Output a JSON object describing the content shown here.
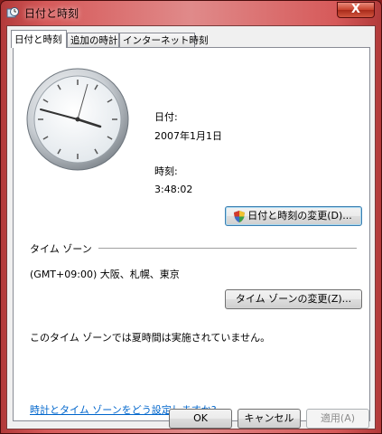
{
  "window": {
    "title": "日付と時刻",
    "close_label": "X"
  },
  "tabs": [
    {
      "label": "日付と時刻"
    },
    {
      "label": "追加の時計"
    },
    {
      "label": "インターネット時刻"
    }
  ],
  "date": {
    "label": "日付:",
    "value": "2007年1月1日"
  },
  "time": {
    "label": "時刻:",
    "value": "3:48:02"
  },
  "change_datetime_button": "日付と時刻の変更(D)...",
  "timezone": {
    "section_label": "タイム ゾーン",
    "value": "(GMT+09:00) 大阪、札幌、東京",
    "change_button": "タイム ゾーンの変更(Z)...",
    "dst_note": "このタイム ゾーンでは夏時間は実施されていません。"
  },
  "help_link": "時計とタイム ゾーンをどう設定しますか?",
  "footer": {
    "ok": "OK",
    "cancel": "キャンセル",
    "apply": "適用(A)"
  }
}
